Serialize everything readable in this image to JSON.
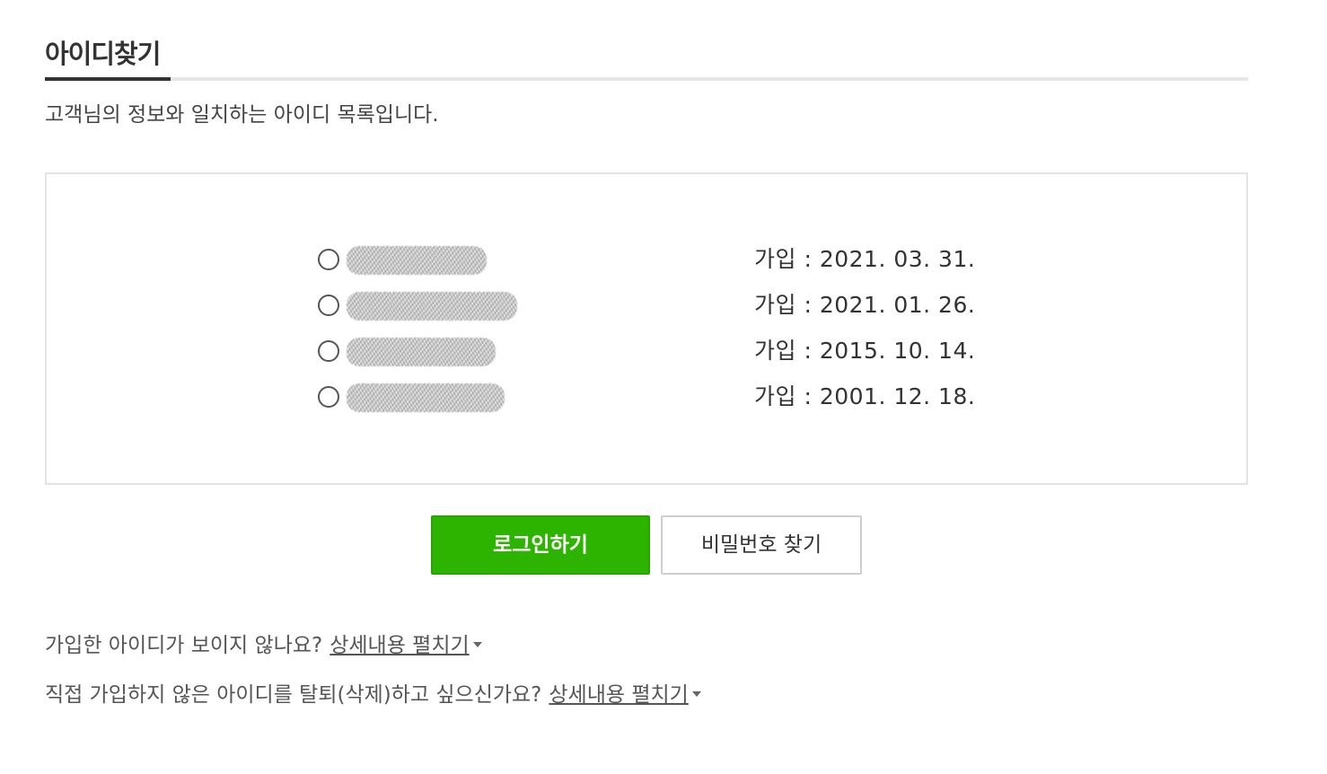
{
  "header": {
    "title": "아이디찾기"
  },
  "subtitle": "고객님의 정보와 일치하는 아이디 목록입니다.",
  "accounts": [
    {
      "join_label": "가입 : 2021. 03. 31."
    },
    {
      "join_label": "가입 : 2021. 01. 26."
    },
    {
      "join_label": "가입 : 2015. 10. 14."
    },
    {
      "join_label": "가입 : 2001. 12. 18."
    }
  ],
  "buttons": {
    "login": "로그인하기",
    "find_password": "비밀번호 찾기"
  },
  "help": [
    {
      "text": "가입한 아이디가 보이지 않나요?",
      "link": "상세내용 펼치기"
    },
    {
      "text": "직접 가입하지 않은 아이디를 탈퇴(삭제)하고 싶으신가요?",
      "link": "상세내용 펼치기"
    }
  ],
  "colors": {
    "primary_green": "#2db400",
    "title_text": "#333333",
    "border_gray": "#e3e3e3"
  },
  "icons": {
    "radio": "radio-unchecked-icon",
    "expand": "caret-down-icon"
  }
}
